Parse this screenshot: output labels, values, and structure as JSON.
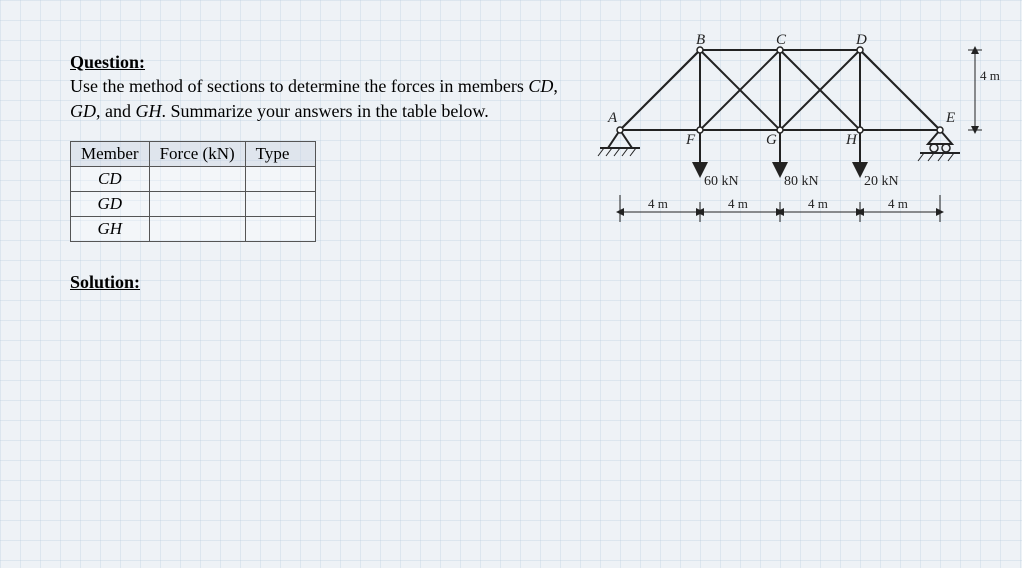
{
  "question": {
    "heading": "Question:",
    "body_part1": "Use the method of sections to determine the forces in members ",
    "m1": "CD",
    "sep1": ", ",
    "m2": "GD",
    "sep2": ", and ",
    "m3": "GH",
    "body_part2": ". Summarize your answers in the table below."
  },
  "table": {
    "headers": {
      "member": "Member",
      "force": "Force (kN)",
      "type": "Type"
    },
    "rows": [
      {
        "member": "CD",
        "force": "",
        "type": ""
      },
      {
        "member": "GD",
        "force": "",
        "type": ""
      },
      {
        "member": "GH",
        "force": "",
        "type": ""
      }
    ]
  },
  "solution_heading": "Solution:",
  "diagram": {
    "nodes": {
      "A": "A",
      "B": "B",
      "C": "C",
      "D": "D",
      "E": "E",
      "F": "F",
      "G": "G",
      "H": "H"
    },
    "loads": {
      "F": "60 kN",
      "G": "80 kN",
      "H": "20 kN"
    },
    "hspan": "4 m",
    "height_label": "4 m"
  },
  "chart_data": {
    "type": "diagram",
    "structure": "Pratt/Warren truss on pin and roller supports",
    "span_segments_m": [
      4,
      4,
      4,
      4
    ],
    "height_m": 4,
    "top_chord_nodes": [
      "A",
      "B",
      "C",
      "D",
      "E"
    ],
    "bottom_chord_nodes": [
      "A",
      "F",
      "G",
      "H",
      "E"
    ],
    "loads_kN": {
      "F": 60,
      "G": 80,
      "H": 20
    },
    "supports": {
      "A": "pin",
      "E": "roller"
    },
    "members_requested": [
      "CD",
      "GD",
      "GH"
    ]
  }
}
